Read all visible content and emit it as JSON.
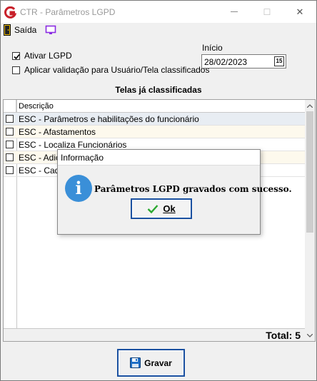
{
  "window": {
    "title": "CTR - Parâmetros LGPD",
    "min_glyph": "—",
    "max_glyph": "☐",
    "close_glyph": "✕"
  },
  "menu": {
    "exit_label": "Saída",
    "exit_icon": "door-exit-icon",
    "monitor_icon": "monitor-icon"
  },
  "options": {
    "ativar_label": "Ativar LGPD",
    "ativar_checked": true,
    "aplicar_label": "Aplicar validação para Usuário/Tela classificados",
    "aplicar_checked": false
  },
  "inicio": {
    "label": "Início",
    "date": "28/02/2023",
    "calendar_text": "15"
  },
  "grid": {
    "title": "Telas já classificadas",
    "column": "Descrição",
    "rows": [
      {
        "text": "ESC - Parâmetros e habilitações do funcionário",
        "checked": false
      },
      {
        "text": "ESC - Afastamentos",
        "checked": false
      },
      {
        "text": "ESC - Localiza Funcionários",
        "checked": false
      },
      {
        "text": "ESC - Adiç",
        "checked": false
      },
      {
        "text": "ESC - Cada",
        "checked": false
      }
    ],
    "total_label": "Total: 5"
  },
  "save_button": {
    "label": "Gravar",
    "icon": "floppy-disk-icon"
  },
  "dialog": {
    "title": "Informação",
    "icon": "info-icon",
    "icon_glyph": "i",
    "message": "Parâmetros LGPD gravados com sucesso.",
    "ok_label": "Ok",
    "ok_icon": "checkmark-icon"
  },
  "colors": {
    "accent": "#1a50a0",
    "info_blue": "#3a8fd8",
    "selected_row": "#e8edf3",
    "alt_row": "#fdf9ed",
    "app_icon_red": "#c8202a",
    "monitor_purple": "#8a2be2"
  }
}
